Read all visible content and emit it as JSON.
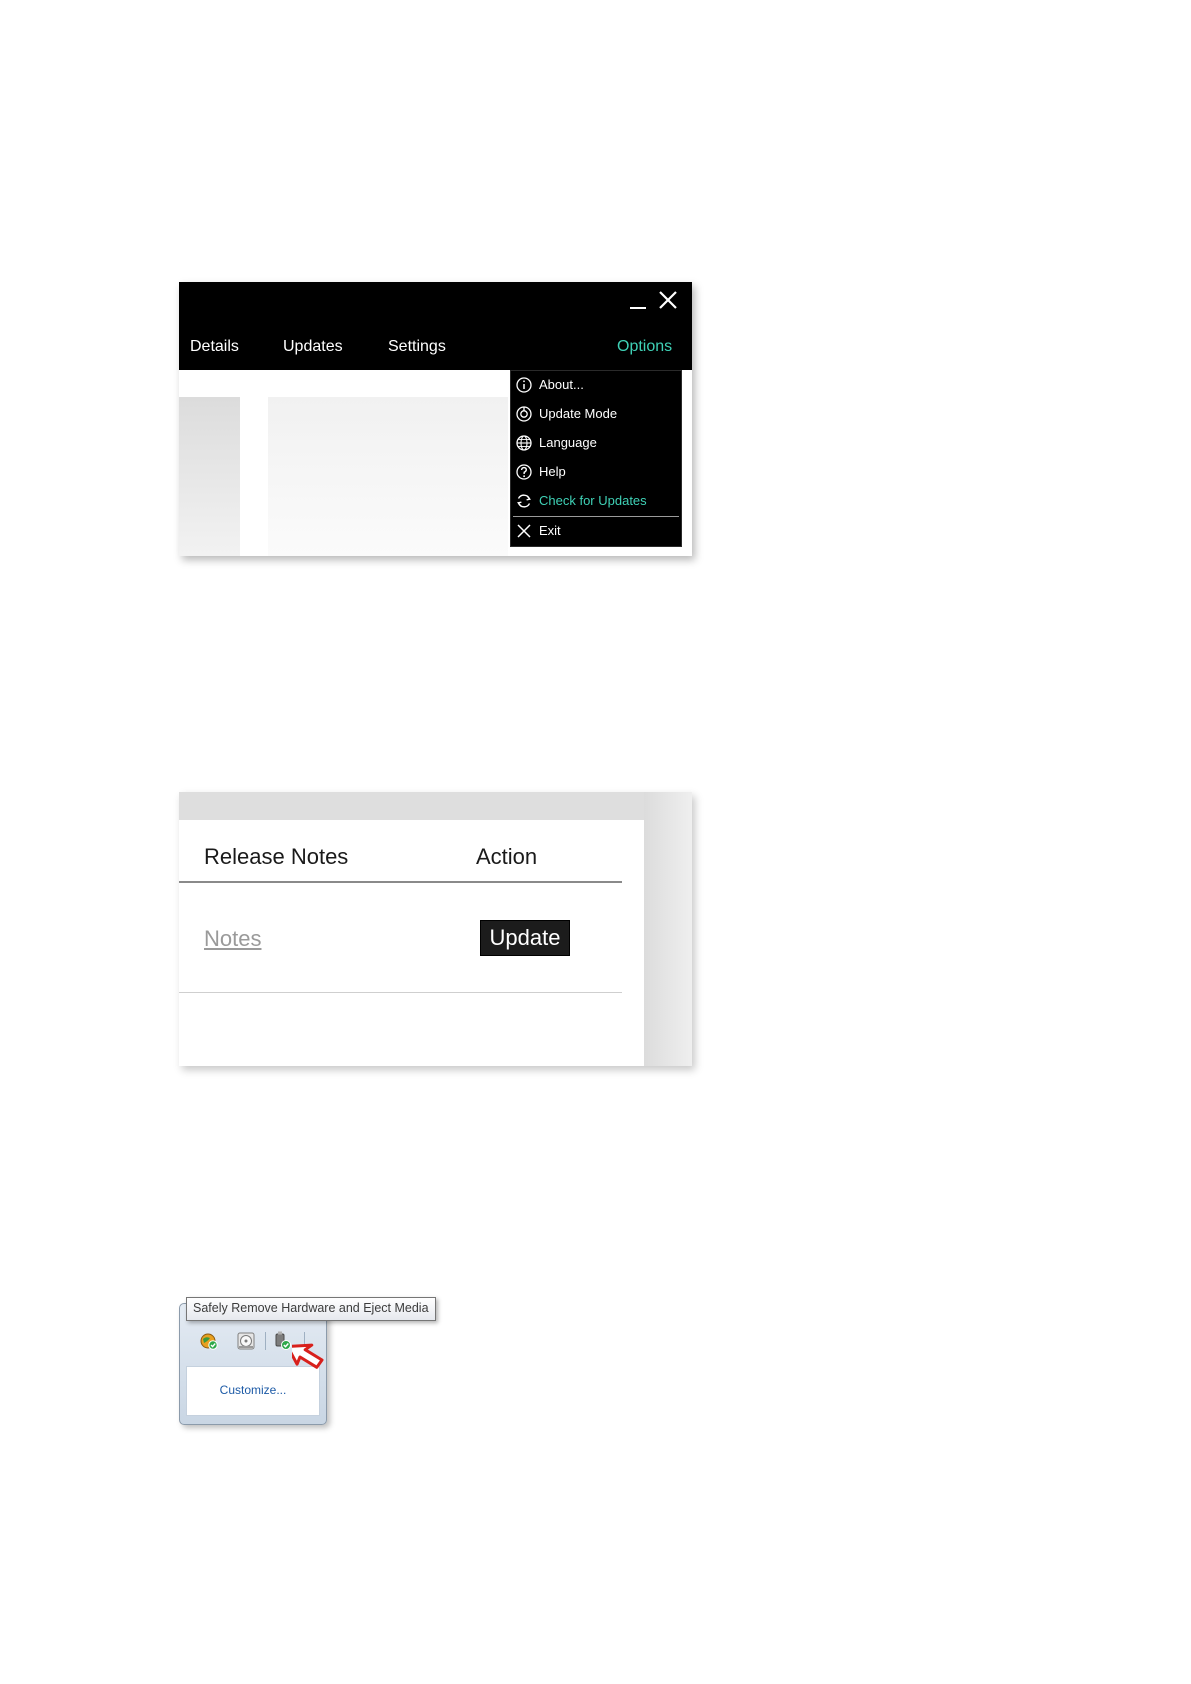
{
  "window1": {
    "controls": {
      "minimize_icon": "minimize-icon",
      "close_icon": "close-icon"
    },
    "tabs": [
      {
        "label": "Details"
      },
      {
        "label": "Updates"
      },
      {
        "label": "Settings"
      },
      {
        "label": "Options",
        "active": true
      }
    ],
    "options_menu": [
      {
        "label": "About...",
        "icon": "info-icon"
      },
      {
        "label": "Update Mode",
        "icon": "update-mode-icon"
      },
      {
        "label": "Language",
        "icon": "globe-icon"
      },
      {
        "label": "Help",
        "icon": "help-icon"
      },
      {
        "label": "Check for Updates",
        "icon": "refresh-icon",
        "highlighted": true
      },
      {
        "label": "Exit",
        "icon": "close-icon"
      }
    ],
    "colors": {
      "accent": "#3fd1b6",
      "header_bg": "#000000"
    }
  },
  "window2": {
    "columns": {
      "release_notes": "Release Notes",
      "action": "Action"
    },
    "row": {
      "notes_link": "Notes",
      "update_button": "Update"
    }
  },
  "tray": {
    "tooltip": "Safely Remove Hardware and Eject Media",
    "icons": [
      "network-globe-icon",
      "disc-icon",
      "usb-eject-icon"
    ],
    "customize_link": "Customize...",
    "pointer_icon": "red-arrow-cursor-icon"
  }
}
